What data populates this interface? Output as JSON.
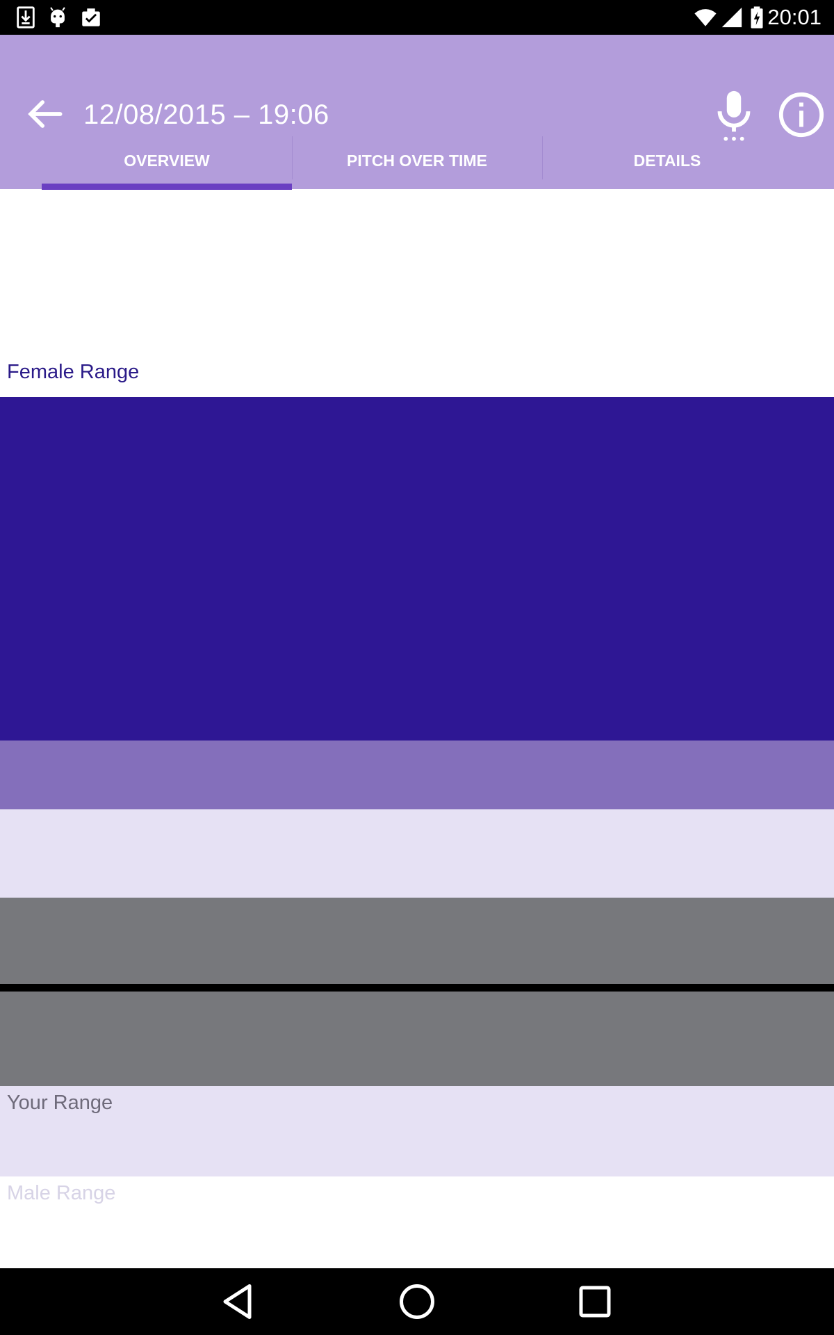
{
  "status_bar": {
    "time": "20:01",
    "left_icons": [
      "download-icon",
      "android-icon",
      "clipboard-check-icon"
    ],
    "right_icons": [
      "wifi-icon",
      "signal-icon",
      "battery-charging-icon"
    ]
  },
  "app_bar": {
    "title": "12/08/2015 – 19:06",
    "back_icon": "arrow-back-icon",
    "actions": [
      "microphone-icon",
      "info-icon"
    ],
    "background": "#b39ddb"
  },
  "tabs": [
    {
      "label": "OVERVIEW",
      "selected": true
    },
    {
      "label": "PITCH OVER TIME",
      "selected": false
    },
    {
      "label": "DETAILS",
      "selected": false
    }
  ],
  "ranges": {
    "female_label": "Female Range",
    "your_label": "Your Range",
    "male_label": "Male Range"
  },
  "colors": {
    "female_band": "#2e1794",
    "overlap_band": "#846fbb",
    "light_band": "#e6e1f4",
    "your_band": "#77787c",
    "tab_indicator": "#6a3fc2"
  },
  "nav_bar": {
    "buttons": [
      "back-triangle-icon",
      "home-circle-icon",
      "recents-square-icon"
    ]
  }
}
